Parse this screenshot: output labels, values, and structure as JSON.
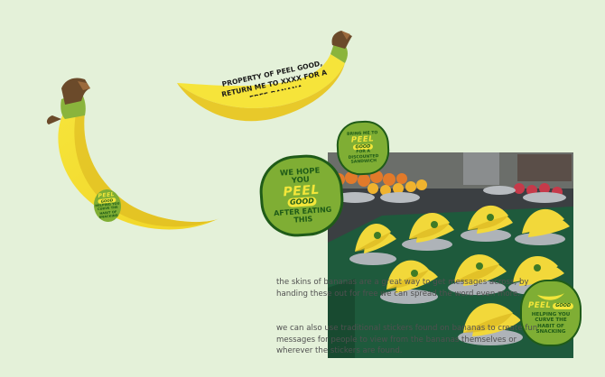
{
  "colors": {
    "background": "#e4f1d9",
    "banana_yellow": "#f6e43a",
    "banana_shadow": "#d9b21d",
    "stem_brown": "#6b4a2a",
    "sticker_green": "#7fae34",
    "sticker_dark": "#1f5b18",
    "text_gray": "#505050"
  },
  "banana_sticker_small": {
    "peel": "PEEL",
    "good": "GOOD",
    "lines": [
      "HELPING YOU",
      "CURVE THE",
      "HABIT OF",
      "SNACKING"
    ]
  },
  "banana_print": {
    "line1": "PROPERTY OF PEEL GOOD,",
    "line2": "RETURN ME TO XXXX FOR A",
    "line3": "FREE BANANA"
  },
  "sticker_we_hope": {
    "line1": "WE HOPE",
    "line2": "YOU",
    "peel": "PEEL",
    "good": "GOOD",
    "line3": "AFTER EATING",
    "line4": "THIS"
  },
  "sticker_bring_me": {
    "line1": "BRING ME TO",
    "peel": "PEEL",
    "good": "GOOD",
    "line2": "FOR A",
    "line3": "DISCOUNTED",
    "line4": "SANDWICH"
  },
  "sticker_helping": {
    "peel": "PEEL",
    "good": "GOOD",
    "line1": "HELPING YOU",
    "line2": "CURVE THE",
    "line3": "HABIT OF",
    "line4": "SNACKING"
  },
  "photo": {
    "icon": "market-stall-bananas-photo"
  },
  "text": {
    "paragraph1": "the skins of bananas are a great way to get messages across, by handing these out for free we can spread the word even more.",
    "paragraph2": "we can also use traditional stickers found on bananas to create fun messages for people to view from the bananas themselves or wherever the stickers are found."
  }
}
